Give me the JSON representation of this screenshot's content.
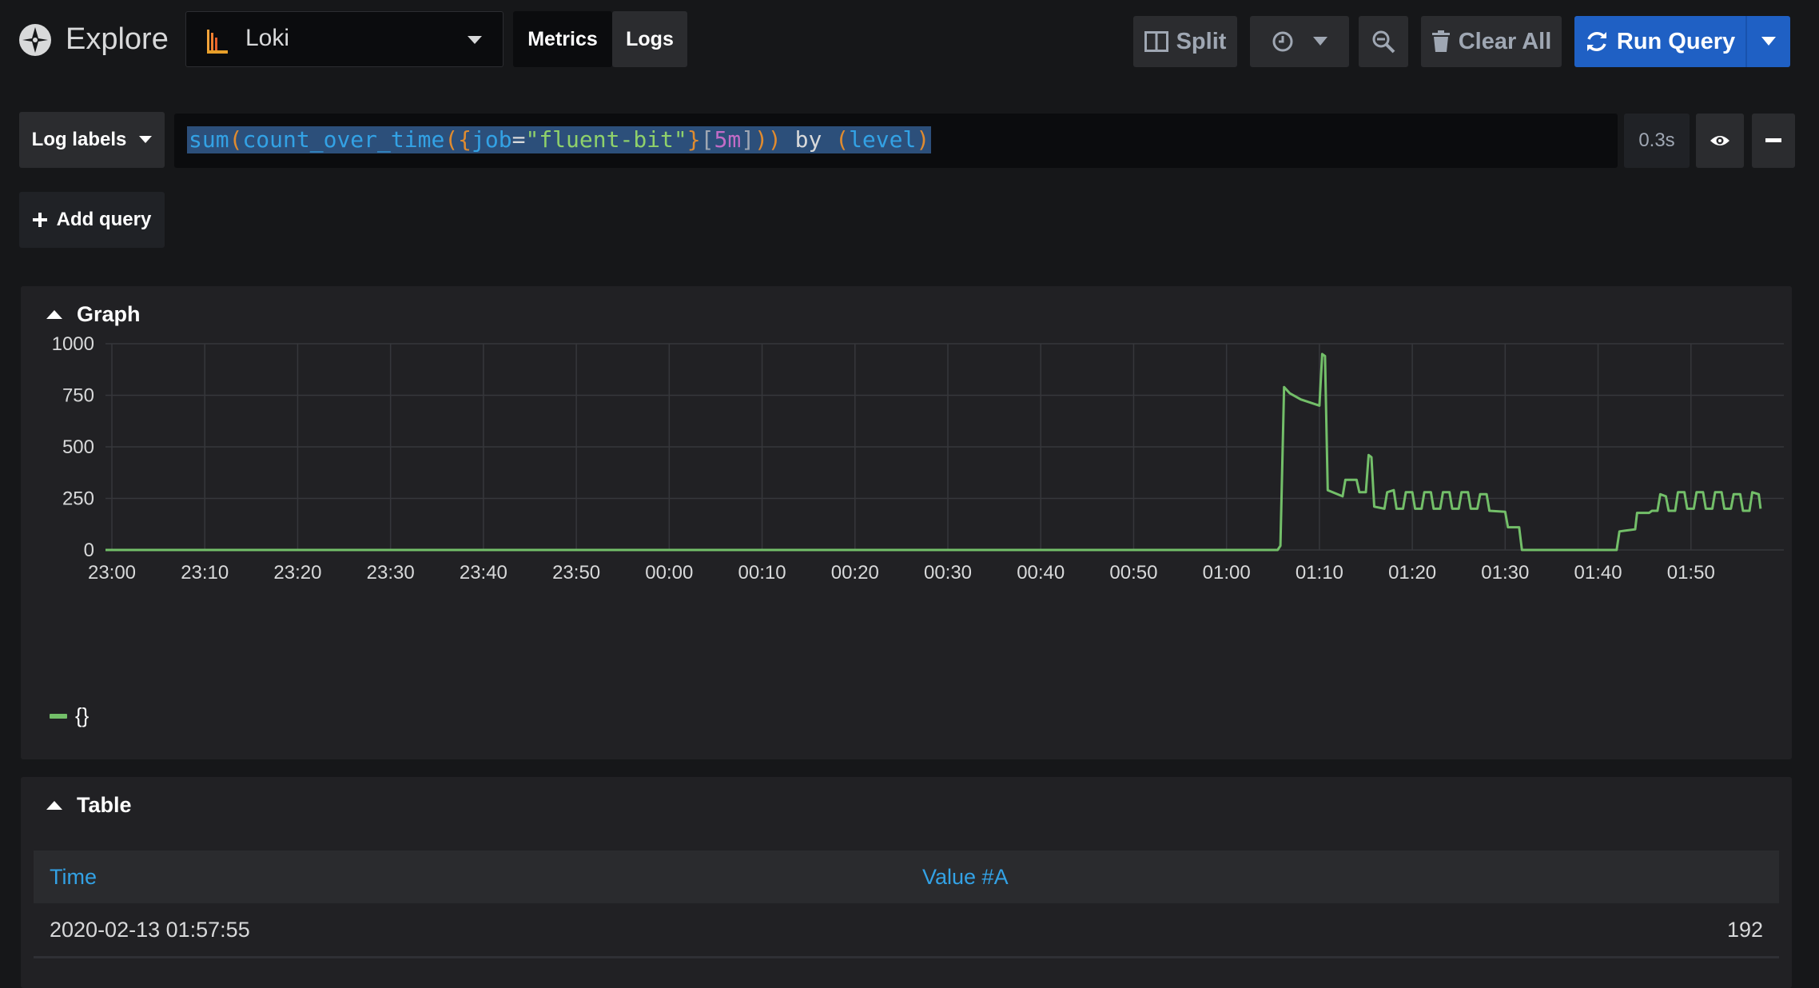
{
  "header": {
    "title": "Explore",
    "datasource": "Loki",
    "modes": [
      "Metrics",
      "Logs"
    ],
    "split_label": "Split",
    "clear_label": "Clear All",
    "run_label": "Run Query"
  },
  "query": {
    "labels_button": "Log labels",
    "tokens": [
      {
        "t": "sum",
        "c": "q-fn"
      },
      {
        "t": "(",
        "c": "q-paren"
      },
      {
        "t": "count_over_time",
        "c": "q-fn"
      },
      {
        "t": "(",
        "c": "q-paren"
      },
      {
        "t": "{",
        "c": "q-paren"
      },
      {
        "t": "job",
        "c": "q-fn"
      },
      {
        "t": "=",
        "c": "q-kw"
      },
      {
        "t": "\"fluent-bit\"",
        "c": "q-str"
      },
      {
        "t": "}",
        "c": "q-paren"
      },
      {
        "t": "[",
        "c": "q-brack"
      },
      {
        "t": "5m",
        "c": "q-dur"
      },
      {
        "t": "]",
        "c": "q-brack"
      },
      {
        "t": ")",
        "c": "q-paren"
      },
      {
        "t": ")",
        "c": "q-paren"
      },
      {
        "t": " by ",
        "c": "q-kw"
      },
      {
        "t": "(",
        "c": "q-paren"
      },
      {
        "t": "level",
        "c": "q-fn"
      },
      {
        "t": ")",
        "c": "q-paren"
      }
    ],
    "duration": "0.3s",
    "add_label": "Add query"
  },
  "graph": {
    "title": "Graph",
    "legend": "{}"
  },
  "chart_data": {
    "type": "line",
    "color": "#73bf69",
    "ylim": [
      0,
      1000
    ],
    "yticks": [
      0,
      250,
      500,
      750,
      1000
    ],
    "xlim": [
      0,
      180
    ],
    "xticks": [
      {
        "v": 0,
        "label": "23:00"
      },
      {
        "v": 10,
        "label": "23:10"
      },
      {
        "v": 20,
        "label": "23:20"
      },
      {
        "v": 30,
        "label": "23:30"
      },
      {
        "v": 40,
        "label": "23:40"
      },
      {
        "v": 50,
        "label": "23:50"
      },
      {
        "v": 60,
        "label": "00:00"
      },
      {
        "v": 70,
        "label": "00:10"
      },
      {
        "v": 80,
        "label": "00:20"
      },
      {
        "v": 90,
        "label": "00:30"
      },
      {
        "v": 100,
        "label": "00:40"
      },
      {
        "v": 110,
        "label": "00:50"
      },
      {
        "v": 120,
        "label": "01:00"
      },
      {
        "v": 130,
        "label": "01:10"
      },
      {
        "v": 140,
        "label": "01:20"
      },
      {
        "v": 150,
        "label": "01:30"
      },
      {
        "v": 160,
        "label": "01:40"
      },
      {
        "v": 170,
        "label": "01:50"
      }
    ],
    "points": [
      [
        -2,
        0
      ],
      [
        125.5,
        0
      ],
      [
        125.8,
        20
      ],
      [
        126.2,
        790
      ],
      [
        126.8,
        760
      ],
      [
        128,
        730
      ],
      [
        130,
        700
      ],
      [
        130.3,
        950
      ],
      [
        130.6,
        940
      ],
      [
        130.9,
        290
      ],
      [
        132.5,
        260
      ],
      [
        132.8,
        340
      ],
      [
        134,
        340
      ],
      [
        134.3,
        280
      ],
      [
        135,
        280
      ],
      [
        135.3,
        460
      ],
      [
        135.6,
        450
      ],
      [
        135.9,
        210
      ],
      [
        137,
        200
      ],
      [
        137.3,
        280
      ],
      [
        138,
        290
      ],
      [
        138.3,
        200
      ],
      [
        139,
        200
      ],
      [
        139.3,
        280
      ],
      [
        140,
        280
      ],
      [
        140.3,
        200
      ],
      [
        141,
        200
      ],
      [
        141.3,
        280
      ],
      [
        142,
        280
      ],
      [
        142.3,
        200
      ],
      [
        143,
        200
      ],
      [
        143.3,
        280
      ],
      [
        144,
        280
      ],
      [
        144.3,
        200
      ],
      [
        145,
        200
      ],
      [
        145.3,
        280
      ],
      [
        146,
        280
      ],
      [
        146.3,
        200
      ],
      [
        147,
        200
      ],
      [
        147.3,
        270
      ],
      [
        148,
        270
      ],
      [
        148.3,
        190
      ],
      [
        150,
        185
      ],
      [
        150.3,
        110
      ],
      [
        151.5,
        110
      ],
      [
        151.8,
        0
      ],
      [
        162,
        0
      ],
      [
        162.3,
        90
      ],
      [
        164,
        100
      ],
      [
        164.2,
        180
      ],
      [
        165.5,
        180
      ],
      [
        165.8,
        190
      ],
      [
        166.4,
        190
      ],
      [
        166.7,
        270
      ],
      [
        167.3,
        260
      ],
      [
        167.6,
        190
      ],
      [
        168.3,
        190
      ],
      [
        168.6,
        280
      ],
      [
        169.3,
        280
      ],
      [
        169.6,
        200
      ],
      [
        170.3,
        200
      ],
      [
        170.6,
        280
      ],
      [
        171.3,
        280
      ],
      [
        171.6,
        200
      ],
      [
        172.3,
        200
      ],
      [
        172.6,
        280
      ],
      [
        173.3,
        280
      ],
      [
        173.6,
        200
      ],
      [
        174.3,
        200
      ],
      [
        174.6,
        270
      ],
      [
        175.3,
        270
      ],
      [
        175.6,
        190
      ],
      [
        176.3,
        190
      ],
      [
        176.6,
        280
      ],
      [
        177.3,
        270
      ],
      [
        177.5,
        200
      ]
    ]
  },
  "table": {
    "title": "Table",
    "columns": [
      "Time",
      "Value #A"
    ],
    "rows": [
      {
        "time": "2020-02-13 01:57:55",
        "value": "192"
      }
    ]
  }
}
